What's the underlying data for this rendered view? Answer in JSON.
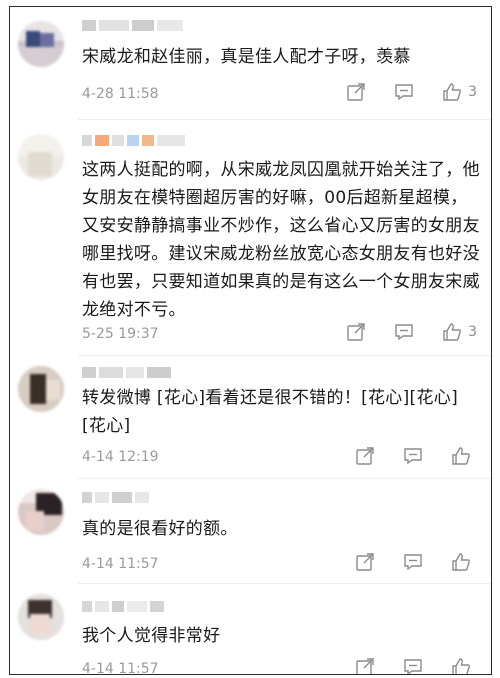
{
  "comments": [
    {
      "text": "宋威龙和赵佳丽，真是佳人配才子呀，羡慕",
      "time": "4-28 11:58",
      "likes": "3"
    },
    {
      "text": "这两人挺配的啊，从宋威龙凤囚凰就开始关注了，他女朋友在模特圈超厉害的好嘛，00后超新星超模，又安安静静搞事业不炒作，这么省心又厉害的女朋友哪里找呀。建议宋威龙粉丝放宽心态女朋友有也好没有也罢，只要知道如果真的是有这么一个女朋友宋威龙绝对不亏。",
      "time": "5-25 19:37",
      "likes": "3"
    },
    {
      "text": "转发微博 [花心]看着还是很不错的！[花心][花心][花心]",
      "time": "4-14 12:19",
      "likes": ""
    },
    {
      "text": "真的是很看好的额。",
      "time": "4-14 11:57",
      "likes": ""
    },
    {
      "text": "我个人觉得非常好",
      "time": "4-14 11:57",
      "likes": ""
    }
  ],
  "icons": {
    "share": "share-icon",
    "comment": "comment-icon",
    "like": "thumbs-up-icon"
  },
  "colors": {
    "text": "#1a1a1a",
    "meta": "#9a9a9a",
    "icon": "#8c8c8c"
  }
}
